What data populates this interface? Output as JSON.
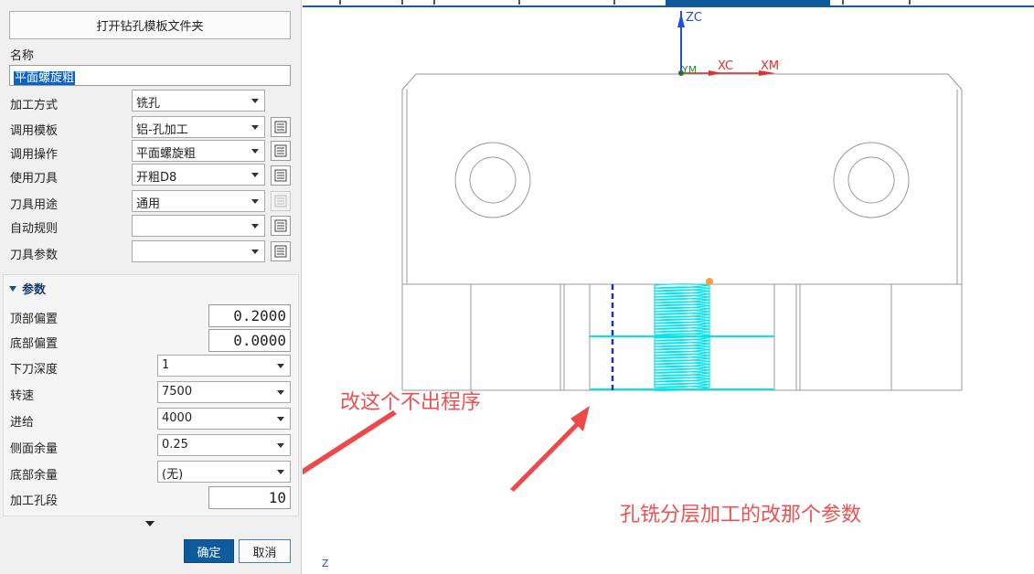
{
  "dialog": {
    "open_folder_button": "打开钻孔模板文件夹",
    "name_label": "名称",
    "name_value": "平面螺旋粗",
    "fields": [
      {
        "label": "加工方式",
        "value": "铣孔"
      },
      {
        "label": "调用模板",
        "value": "铝-孔加工"
      },
      {
        "label": "调用操作",
        "value": "平面螺旋粗"
      },
      {
        "label": "使用刀具",
        "value": "开粗D8"
      },
      {
        "label": "刀具用途",
        "value": "通用"
      },
      {
        "label": "自动规则",
        "value": ""
      },
      {
        "label": "刀具参数",
        "value": ""
      }
    ],
    "params_section": {
      "title": "参数",
      "top_offset_label": "顶部偏置",
      "top_offset_value": "0.2000",
      "bottom_offset_label": "底部偏置",
      "bottom_offset_value": "0.0000",
      "step_depth_label": "下刀深度",
      "step_depth_value": "1",
      "spindle_label": "转速",
      "spindle_value": "7500",
      "feed_label": "进给",
      "feed_value": "4000",
      "side_stock_label": "侧面余量",
      "side_stock_value": "0.25",
      "floor_stock_label": "底部余量",
      "floor_stock_value": "(无)",
      "hole_segments_label": "加工孔段",
      "hole_segments_value": "10"
    },
    "ok_button": "确定",
    "cancel_button": "取消"
  },
  "viewport": {
    "axis_zc": "ZC",
    "axis_xc": "XC",
    "axis_xm": "XM",
    "axis_ym": "YM",
    "corner_z": "Z",
    "colors": {
      "part_edges": "#9a9a9a",
      "toolpath": "#00e5ef",
      "zc_axis": "#1f50d8",
      "xc_axis": "#e03030",
      "annotation": "#f05050"
    }
  },
  "annotations": {
    "note_left": "改这个不出程序",
    "note_right": "孔铣分层加工的改那个参数"
  }
}
